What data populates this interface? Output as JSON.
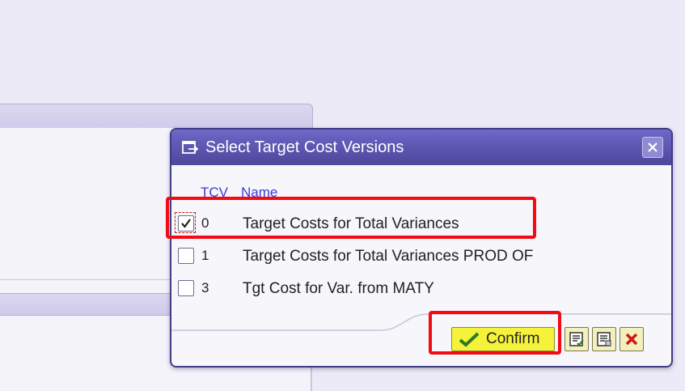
{
  "dialog": {
    "title": "Select Target Cost Versions",
    "columns": {
      "tcv": "TCV",
      "name": "Name"
    },
    "rows": [
      {
        "tcv": "0",
        "name": "Target Costs for Total Variances",
        "checked": true
      },
      {
        "tcv": "1",
        "name": "Target Costs for Total Variances PROD OF",
        "checked": false
      },
      {
        "tcv": "3",
        "name": "Tgt Cost for Var. from MATY",
        "checked": false
      }
    ],
    "confirm_label": "Confirm",
    "icons": {
      "title": "dialog-select-icon",
      "close": "close-icon",
      "confirm": "checkmark-icon",
      "select_all": "select-all-icon",
      "deselect_all": "deselect-all-icon",
      "cancel": "cancel-x-icon"
    }
  },
  "colors": {
    "title_bar": "#5a54b0",
    "header_text": "#3a3ad8",
    "highlight": "#f20b12",
    "confirm_bg": "#f6f23a",
    "cancel_x": "#d01818"
  }
}
